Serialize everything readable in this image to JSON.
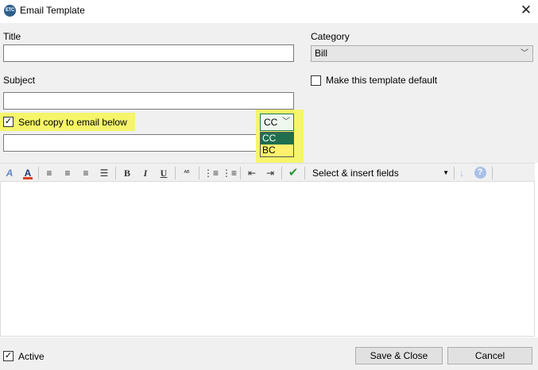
{
  "window": {
    "title": "Email Template",
    "icon": "app-logo-icon",
    "icon_text": "ETC"
  },
  "form": {
    "title_label": "Title",
    "title_value": "",
    "category_label": "Category",
    "category_value": "Bill",
    "subject_label": "Subject",
    "subject_value": "",
    "default_label": "Make this template default",
    "default_checked": false,
    "send_copy_label": "Send copy to email below",
    "send_copy_checked": true,
    "copy_type_value": "CC",
    "copy_type_options": [
      "CC",
      "BC"
    ],
    "copy_email_value": ""
  },
  "toolbar": {
    "fields_select": "Select & insert fields"
  },
  "footer": {
    "active_label": "Active",
    "active_checked": true,
    "save_label": "Save & Close",
    "cancel_label": "Cancel"
  },
  "colors": {
    "highlight": "#f5f56a",
    "dropdown_selected": "#1f6e4e",
    "accent_check": "#2a9a3a"
  }
}
